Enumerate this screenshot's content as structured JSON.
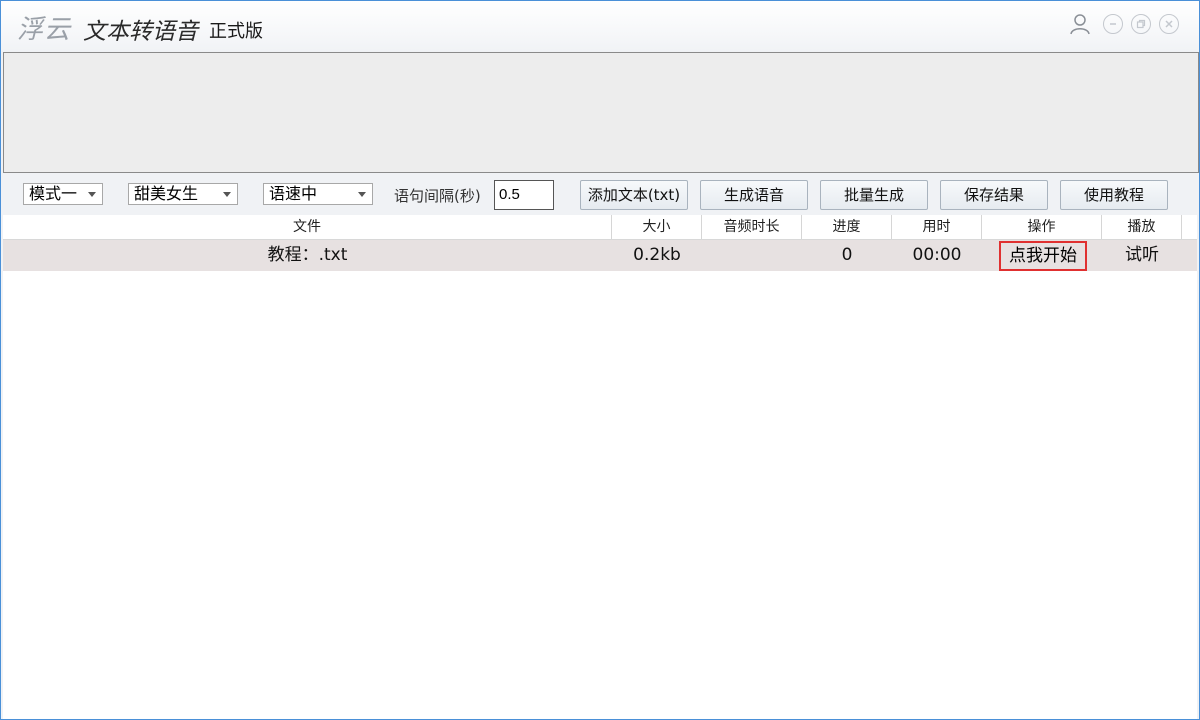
{
  "title_bar": {
    "logo": "浮云",
    "app_name": "文本转语音",
    "edition": "正式版",
    "icons": [
      "user-icon",
      "minimize-icon",
      "restore-icon",
      "close-icon"
    ]
  },
  "toolbar": {
    "mode": "模式一",
    "voice": "甜美女生",
    "speed": "语速中",
    "interval_label": "语句间隔(秒)",
    "interval_value": "0.5",
    "add_text": "添加文本(txt)",
    "generate": "生成语音",
    "batch": "批量生成",
    "save": "保存结果",
    "tutorial": "使用教程"
  },
  "table": {
    "columns": [
      "文件",
      "大小",
      "音频时长",
      "进度",
      "用时",
      "操作",
      "播放"
    ],
    "rows": [
      {
        "file": "教程：.txt",
        "size": "0.2kb",
        "duration": "",
        "progress": "0",
        "time": "00:00",
        "action": "点我开始",
        "play": "试听"
      }
    ]
  },
  "colors": {
    "border_accent": "#4a90d8",
    "row_bg": "#e7e1e1",
    "action_border": "#e03030"
  }
}
